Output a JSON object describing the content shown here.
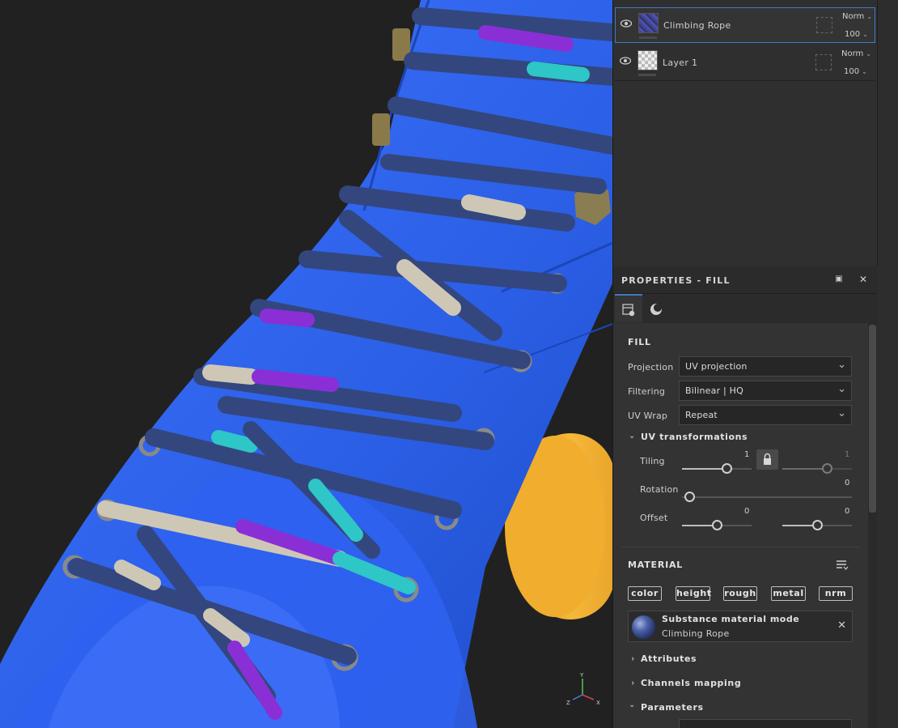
{
  "layers": [
    {
      "name": "Climbing Rope",
      "blend": "Norm",
      "opacity": "100",
      "selected": true
    },
    {
      "name": "Layer 1",
      "blend": "Norm",
      "opacity": "100",
      "selected": false
    }
  ],
  "properties": {
    "title": "PROPERTIES - FILL",
    "fill_section": "FILL",
    "projection_label": "Projection",
    "projection_value": "UV projection",
    "filtering_label": "Filtering",
    "filtering_value": "Bilinear | HQ",
    "uvwrap_label": "UV Wrap",
    "uvwrap_value": "Repeat",
    "uv_transformations": "UV transformations",
    "tiling_label": "Tiling",
    "tiling_value_1": "1",
    "tiling_value_2": "1",
    "rotation_label": "Rotation",
    "rotation_value": "0",
    "offset_label": "Offset",
    "offset_value_1": "0",
    "offset_value_2": "0",
    "material_section": "MATERIAL",
    "channels": [
      "color",
      "height",
      "rough",
      "metal",
      "nrm"
    ],
    "material_mode": "Substance material mode",
    "material_name": "Climbing Rope",
    "attributes": "Attributes",
    "channels_mapping": "Channels mapping",
    "parameters": "Parameters"
  },
  "gizmo": {
    "x": "X",
    "y": "Y",
    "z": "Z"
  },
  "colors": {
    "accent": "#3f79c6",
    "panel": "#333333",
    "shoe_blue": "#2f62e8",
    "wheel": "#f2b130"
  }
}
